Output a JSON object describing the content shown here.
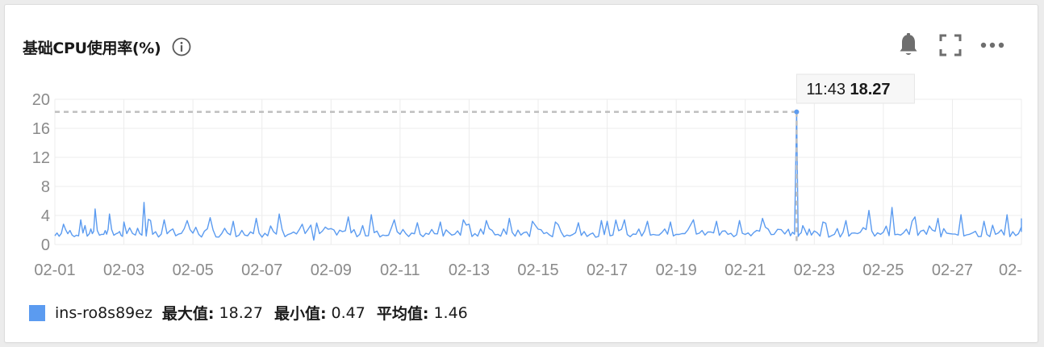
{
  "panel": {
    "title": "基础CPU使用率(%)",
    "icons": {
      "info": "info-circle-icon",
      "alarm": "bell-icon",
      "fullscreen": "fullscreen-icon",
      "more": "more-dots-icon"
    }
  },
  "tooltip": {
    "time": "11:43",
    "value": "18.27"
  },
  "legend": {
    "series_name": "ins-ro8s89ez",
    "max_label": "最大值:",
    "max_value": "18.27",
    "min_label": "最小值:",
    "min_value": "0.47",
    "avg_label": "平均值:",
    "avg_value": "1.46"
  },
  "colors": {
    "series": "#5b9bf0",
    "grid": "#ececec",
    "axis_text": "#8a8a8a",
    "crosshair": "#bfbfbf"
  },
  "chart_data": {
    "type": "line",
    "title": "基础CPU使用率(%)",
    "xlabel": "",
    "ylabel": "",
    "ylim": [
      0,
      20
    ],
    "yticks": [
      0,
      4,
      8,
      12,
      16,
      20
    ],
    "xlim_days": [
      1,
      29
    ],
    "xticks": [
      "02-01",
      "02-03",
      "02-05",
      "02-07",
      "02-09",
      "02-11",
      "02-13",
      "02-15",
      "02-17",
      "02-19",
      "02-21",
      "02-23",
      "02-25",
      "02-27",
      "02-"
    ],
    "grid": true,
    "series": [
      {
        "name": "ins-ro8s89ez",
        "peaks": [
          [
            "02-01 00:00",
            1.2
          ],
          [
            "02-01 06:00",
            2.8
          ],
          [
            "02-01 12:00",
            1.3
          ],
          [
            "02-01 18:00",
            3.4
          ],
          [
            "02-02 00:00",
            1.5
          ],
          [
            "02-02 04:00",
            4.9
          ],
          [
            "02-02 10:00",
            1.4
          ],
          [
            "02-02 14:00",
            4.2
          ],
          [
            "02-02 20:00",
            1.6
          ],
          [
            "02-03 00:00",
            3.1
          ],
          [
            "02-03 08:00",
            1.3
          ],
          [
            "02-03 14:00",
            5.8
          ],
          [
            "02-03 20:00",
            1.4
          ],
          [
            "02-04 04:00",
            3.4
          ],
          [
            "02-04 12:00",
            1.2
          ],
          [
            "02-04 20:00",
            3.3
          ],
          [
            "02-05 04:00",
            1.4
          ],
          [
            "02-05 12:00",
            3.7
          ],
          [
            "02-05 20:00",
            1.5
          ],
          [
            "02-06 04:00",
            3.2
          ],
          [
            "02-06 12:00",
            1.3
          ],
          [
            "02-06 20:00",
            3.6
          ],
          [
            "02-07 04:00",
            1.2
          ],
          [
            "02-07 12:00",
            4.2
          ],
          [
            "02-07 20:00",
            1.5
          ],
          [
            "02-08 04:00",
            2.8
          ],
          [
            "02-08 12:00",
            0.6
          ],
          [
            "02-08 20:00",
            2.4
          ],
          [
            "02-09 04:00",
            1.3
          ],
          [
            "02-09 12:00",
            3.8
          ],
          [
            "02-09 20:00",
            1.4
          ],
          [
            "02-10 04:00",
            4.1
          ],
          [
            "02-10 12:00",
            1.3
          ],
          [
            "02-10 20:00",
            3.4
          ],
          [
            "02-11 04:00",
            1.5
          ],
          [
            "02-11 12:00",
            3.0
          ],
          [
            "02-11 20:00",
            1.4
          ],
          [
            "02-12 04:00",
            3.1
          ],
          [
            "02-12 12:00",
            1.3
          ],
          [
            "02-12 20:00",
            3.4
          ],
          [
            "02-13 04:00",
            1.5
          ],
          [
            "02-13 12:00",
            3.3
          ],
          [
            "02-13 20:00",
            1.4
          ],
          [
            "02-14 04:00",
            3.6
          ],
          [
            "02-14 12:00",
            1.3
          ],
          [
            "02-14 20:00",
            3.2
          ],
          [
            "02-15 04:00",
            1.5
          ],
          [
            "02-15 12:00",
            3.1
          ],
          [
            "02-15 20:00",
            1.3
          ],
          [
            "02-16 04:00",
            3.0
          ],
          [
            "02-16 12:00",
            1.4
          ],
          [
            "02-16 20:00",
            3.3
          ],
          [
            "02-17 04:00",
            1.3
          ],
          [
            "02-17 12:00",
            3.4
          ],
          [
            "02-17 20:00",
            1.4
          ],
          [
            "02-18 04:00",
            3.2
          ],
          [
            "02-18 12:00",
            1.3
          ],
          [
            "02-18 20:00",
            3.1
          ],
          [
            "02-19 04:00",
            1.5
          ],
          [
            "02-19 12:00",
            3.4
          ],
          [
            "02-19 20:00",
            1.3
          ],
          [
            "02-20 04:00",
            3.2
          ],
          [
            "02-20 12:00",
            1.4
          ],
          [
            "02-20 20:00",
            3.3
          ],
          [
            "02-21 04:00",
            1.2
          ],
          [
            "02-21 12:00",
            3.6
          ],
          [
            "02-21 20:00",
            1.4
          ],
          [
            "02-22 06:00",
            2.1
          ],
          [
            "02-22 11:43",
            18.27
          ],
          [
            "02-22 16:00",
            2.6
          ],
          [
            "02-22 22:00",
            1.3
          ],
          [
            "02-23 06:00",
            3.1
          ],
          [
            "02-23 14:00",
            1.4
          ],
          [
            "02-23 22:00",
            3.3
          ],
          [
            "02-24 06:00",
            1.5
          ],
          [
            "02-24 14:00",
            4.7
          ],
          [
            "02-24 22:00",
            1.4
          ],
          [
            "02-25 06:00",
            5.1
          ],
          [
            "02-25 14:00",
            1.6
          ],
          [
            "02-25 22:00",
            3.8
          ],
          [
            "02-26 06:00",
            1.4
          ],
          [
            "02-26 14:00",
            3.6
          ],
          [
            "02-26 22:00",
            1.5
          ],
          [
            "02-27 06:00",
            4.1
          ],
          [
            "02-27 14:00",
            1.6
          ],
          [
            "02-27 22:00",
            3.2
          ],
          [
            "02-28 06:00",
            1.4
          ],
          [
            "02-28 14:00",
            4.1
          ],
          [
            "02-28 22:00",
            1.5
          ],
          [
            "02-29 06:00",
            3.6
          ]
        ]
      }
    ]
  }
}
